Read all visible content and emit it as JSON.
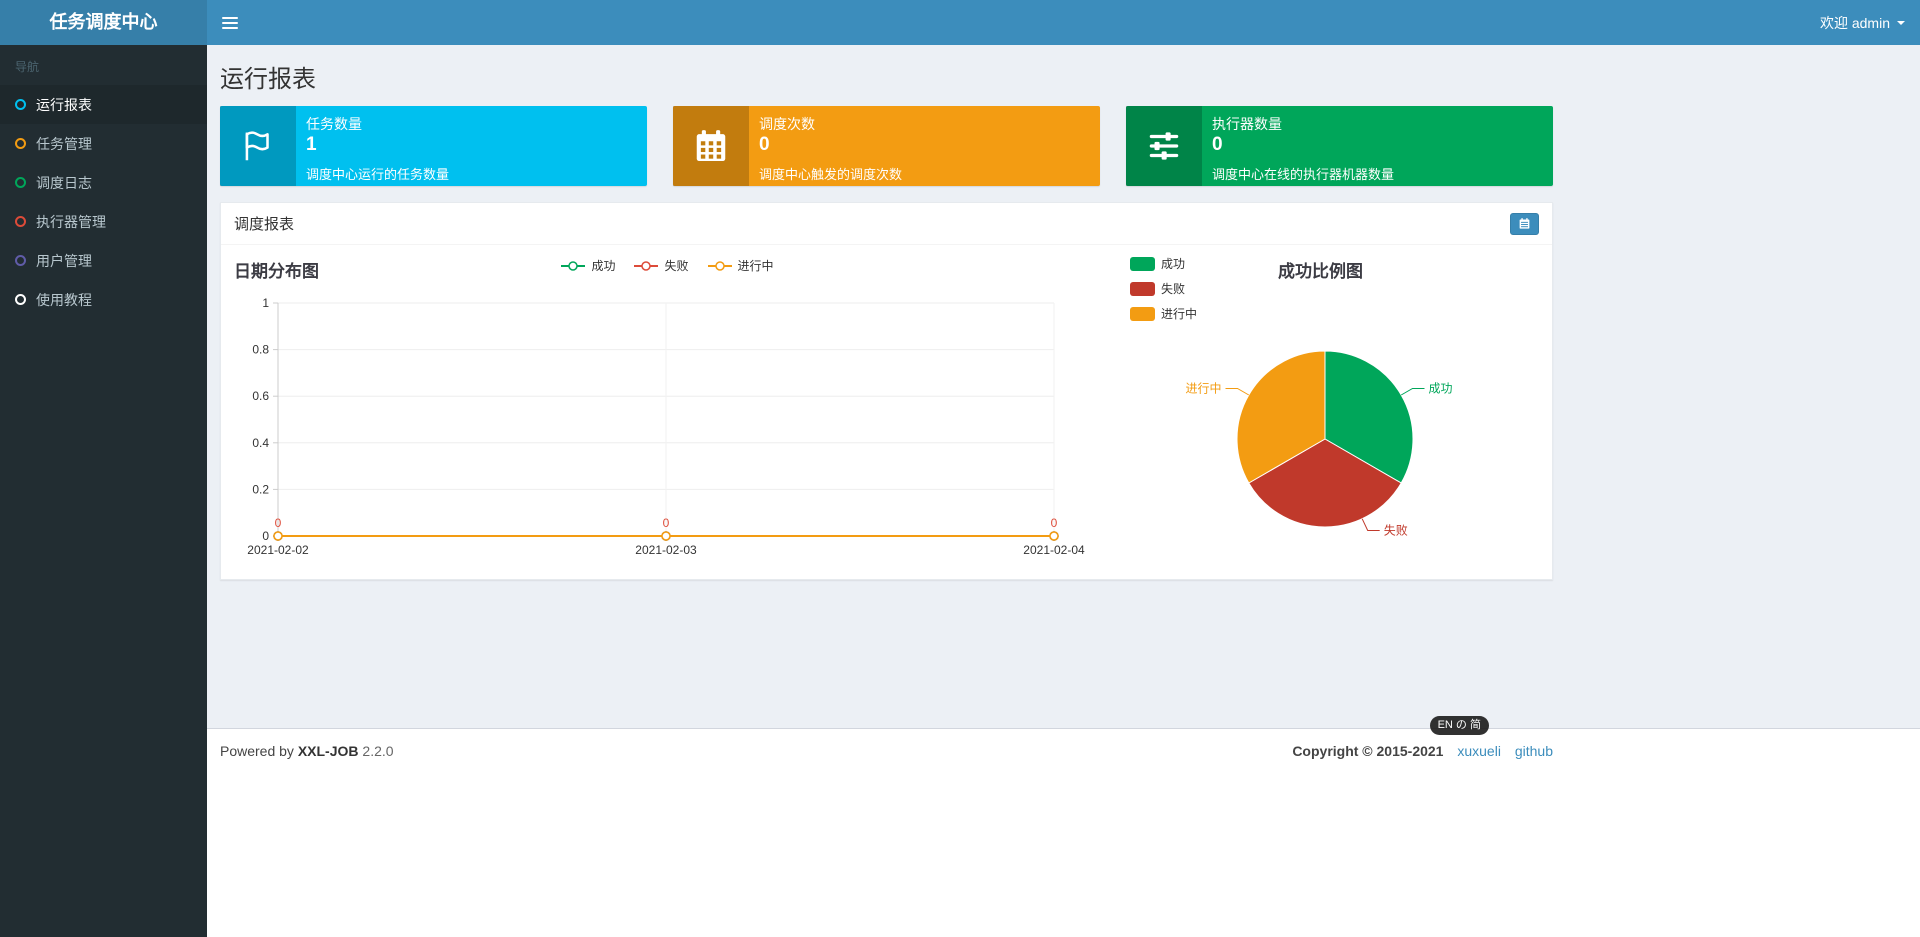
{
  "header": {
    "brand": "任务调度中心",
    "welcome": "欢迎 admin"
  },
  "sidebar": {
    "section_label": "导航",
    "items": [
      {
        "label": "运行报表",
        "color": "#00c0ef",
        "active": true
      },
      {
        "label": "任务管理",
        "color": "#f39c12",
        "active": false
      },
      {
        "label": "调度日志",
        "color": "#00a65a",
        "active": false
      },
      {
        "label": "执行器管理",
        "color": "#dd4b39",
        "active": false
      },
      {
        "label": "用户管理",
        "color": "#605ca8",
        "active": false
      },
      {
        "label": "使用教程",
        "color": "#ffffff",
        "active": false
      }
    ]
  },
  "page": {
    "title": "运行报表"
  },
  "info_boxes": [
    {
      "label": "任务数量",
      "value": "1",
      "description": "调度中心运行的任务数量",
      "color": "#00c0ef",
      "icon": "flag-icon"
    },
    {
      "label": "调度次数",
      "value": "0",
      "description": "调度中心触发的调度次数",
      "color": "#f39c12",
      "icon": "calendar-icon"
    },
    {
      "label": "执行器数量",
      "value": "0",
      "description": "调度中心在线的执行器机器数量",
      "color": "#00a65a",
      "icon": "sliders-icon"
    }
  ],
  "panel": {
    "title": "调度报表"
  },
  "chart_data": [
    {
      "type": "line",
      "title": "日期分布图",
      "x": [
        "2021-02-02",
        "2021-02-03",
        "2021-02-04"
      ],
      "series": [
        {
          "name": "成功",
          "color": "#00a65a",
          "values": [
            0,
            0,
            0
          ]
        },
        {
          "name": "失败",
          "color": "#dd4b39",
          "values": [
            0,
            0,
            0
          ]
        },
        {
          "name": "进行中",
          "color": "#f39c12",
          "values": [
            0,
            0,
            0
          ]
        }
      ],
      "ylim": [
        0,
        1
      ],
      "yticks": [
        0,
        0.2,
        0.4,
        0.6,
        0.8,
        1
      ],
      "point_labels": [
        "0",
        "0",
        "0"
      ],
      "point_label_color": "#dd4b39",
      "legend_position": "top",
      "grid": true
    },
    {
      "type": "pie",
      "title": "成功比例图",
      "slices": [
        {
          "name": "成功",
          "value": 0,
          "display_fraction": 0.3333,
          "color": "#00a65a"
        },
        {
          "name": "失败",
          "value": 0,
          "display_fraction": 0.3333,
          "color": "#c0392b"
        },
        {
          "name": "进行中",
          "value": 0,
          "display_fraction": 0.3333,
          "color": "#f39c12"
        }
      ],
      "legend_position": "left"
    }
  ],
  "footer": {
    "powered_prefix": "Powered by",
    "product": "XXL-JOB",
    "version": "2.2.0",
    "copyright": "Copyright © 2015-2021",
    "links": [
      {
        "label": "xuxueli"
      },
      {
        "label": "github"
      }
    ]
  },
  "ime_indicator": "EN の 简",
  "colors": {
    "navbar": "#3c8dbc",
    "logo_bg": "#367fa9",
    "sidebar_bg": "#222d32",
    "sidebar_active_bg": "#1e282c",
    "content_bg": "#ecf0f5",
    "accent_button": "#3c8dbc"
  }
}
